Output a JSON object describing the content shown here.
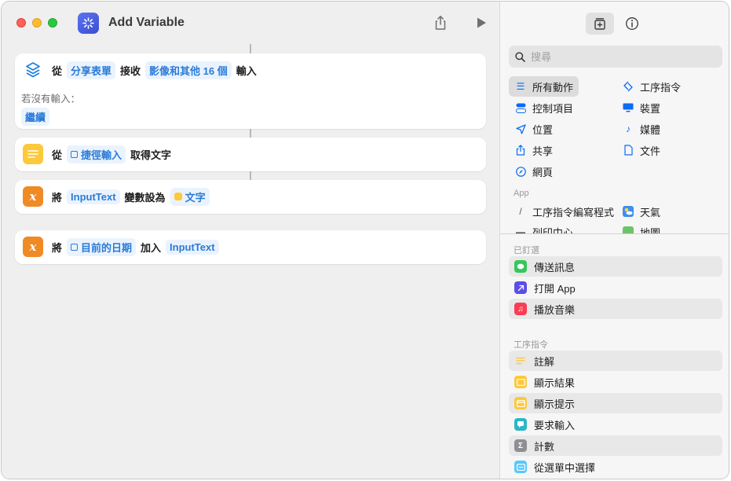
{
  "window": {
    "title": "Add Variable"
  },
  "actions": [
    {
      "verb": "從",
      "source": "分享表單",
      "receive": "接收",
      "types": "影像和其他 16 個",
      "input": "輸入",
      "no_input_label": "若沒有輸入：",
      "no_input_action": "繼續"
    },
    {
      "verb": "從",
      "token": "捷徑輸入",
      "suffix": "取得文字"
    },
    {
      "verb": "將",
      "variable": "InputText",
      "middle": "變數設為",
      "value": "文字"
    },
    {
      "verb": "將",
      "value": "目前的日期",
      "middle": "加入",
      "variable": "InputText"
    }
  ],
  "panel": {
    "search_placeholder": "搜尋",
    "categories_left": [
      "所有動作",
      "控制項目",
      "位置",
      "共享",
      "網頁"
    ],
    "categories_right": [
      "工序指令",
      "裝置",
      "媒體",
      "文件"
    ],
    "app_section": "App",
    "apps": [
      "工序指令編寫程式",
      "天氣",
      "列印中心",
      "地圖"
    ],
    "pinned_section": "已釘選",
    "pinned": [
      "傳送訊息",
      "打開 App",
      "播放音樂"
    ],
    "scripting_section": "工序指令",
    "scripting": [
      "註解",
      "顯示結果",
      "顯示提示",
      "要求輸入",
      "計數",
      "從選單中選擇"
    ]
  },
  "colors": {
    "token_blue": "#2a7bd7",
    "token_bg": "#eaf3fd",
    "variable_orange": "#f08a24",
    "text_yellow": "#fdc93a",
    "accent": "#0a6cf5"
  },
  "icons": {
    "share_sheet": "share-sheet-layers-icon",
    "get_text": "text-lines-icon",
    "variable": "x-variable-icon"
  }
}
